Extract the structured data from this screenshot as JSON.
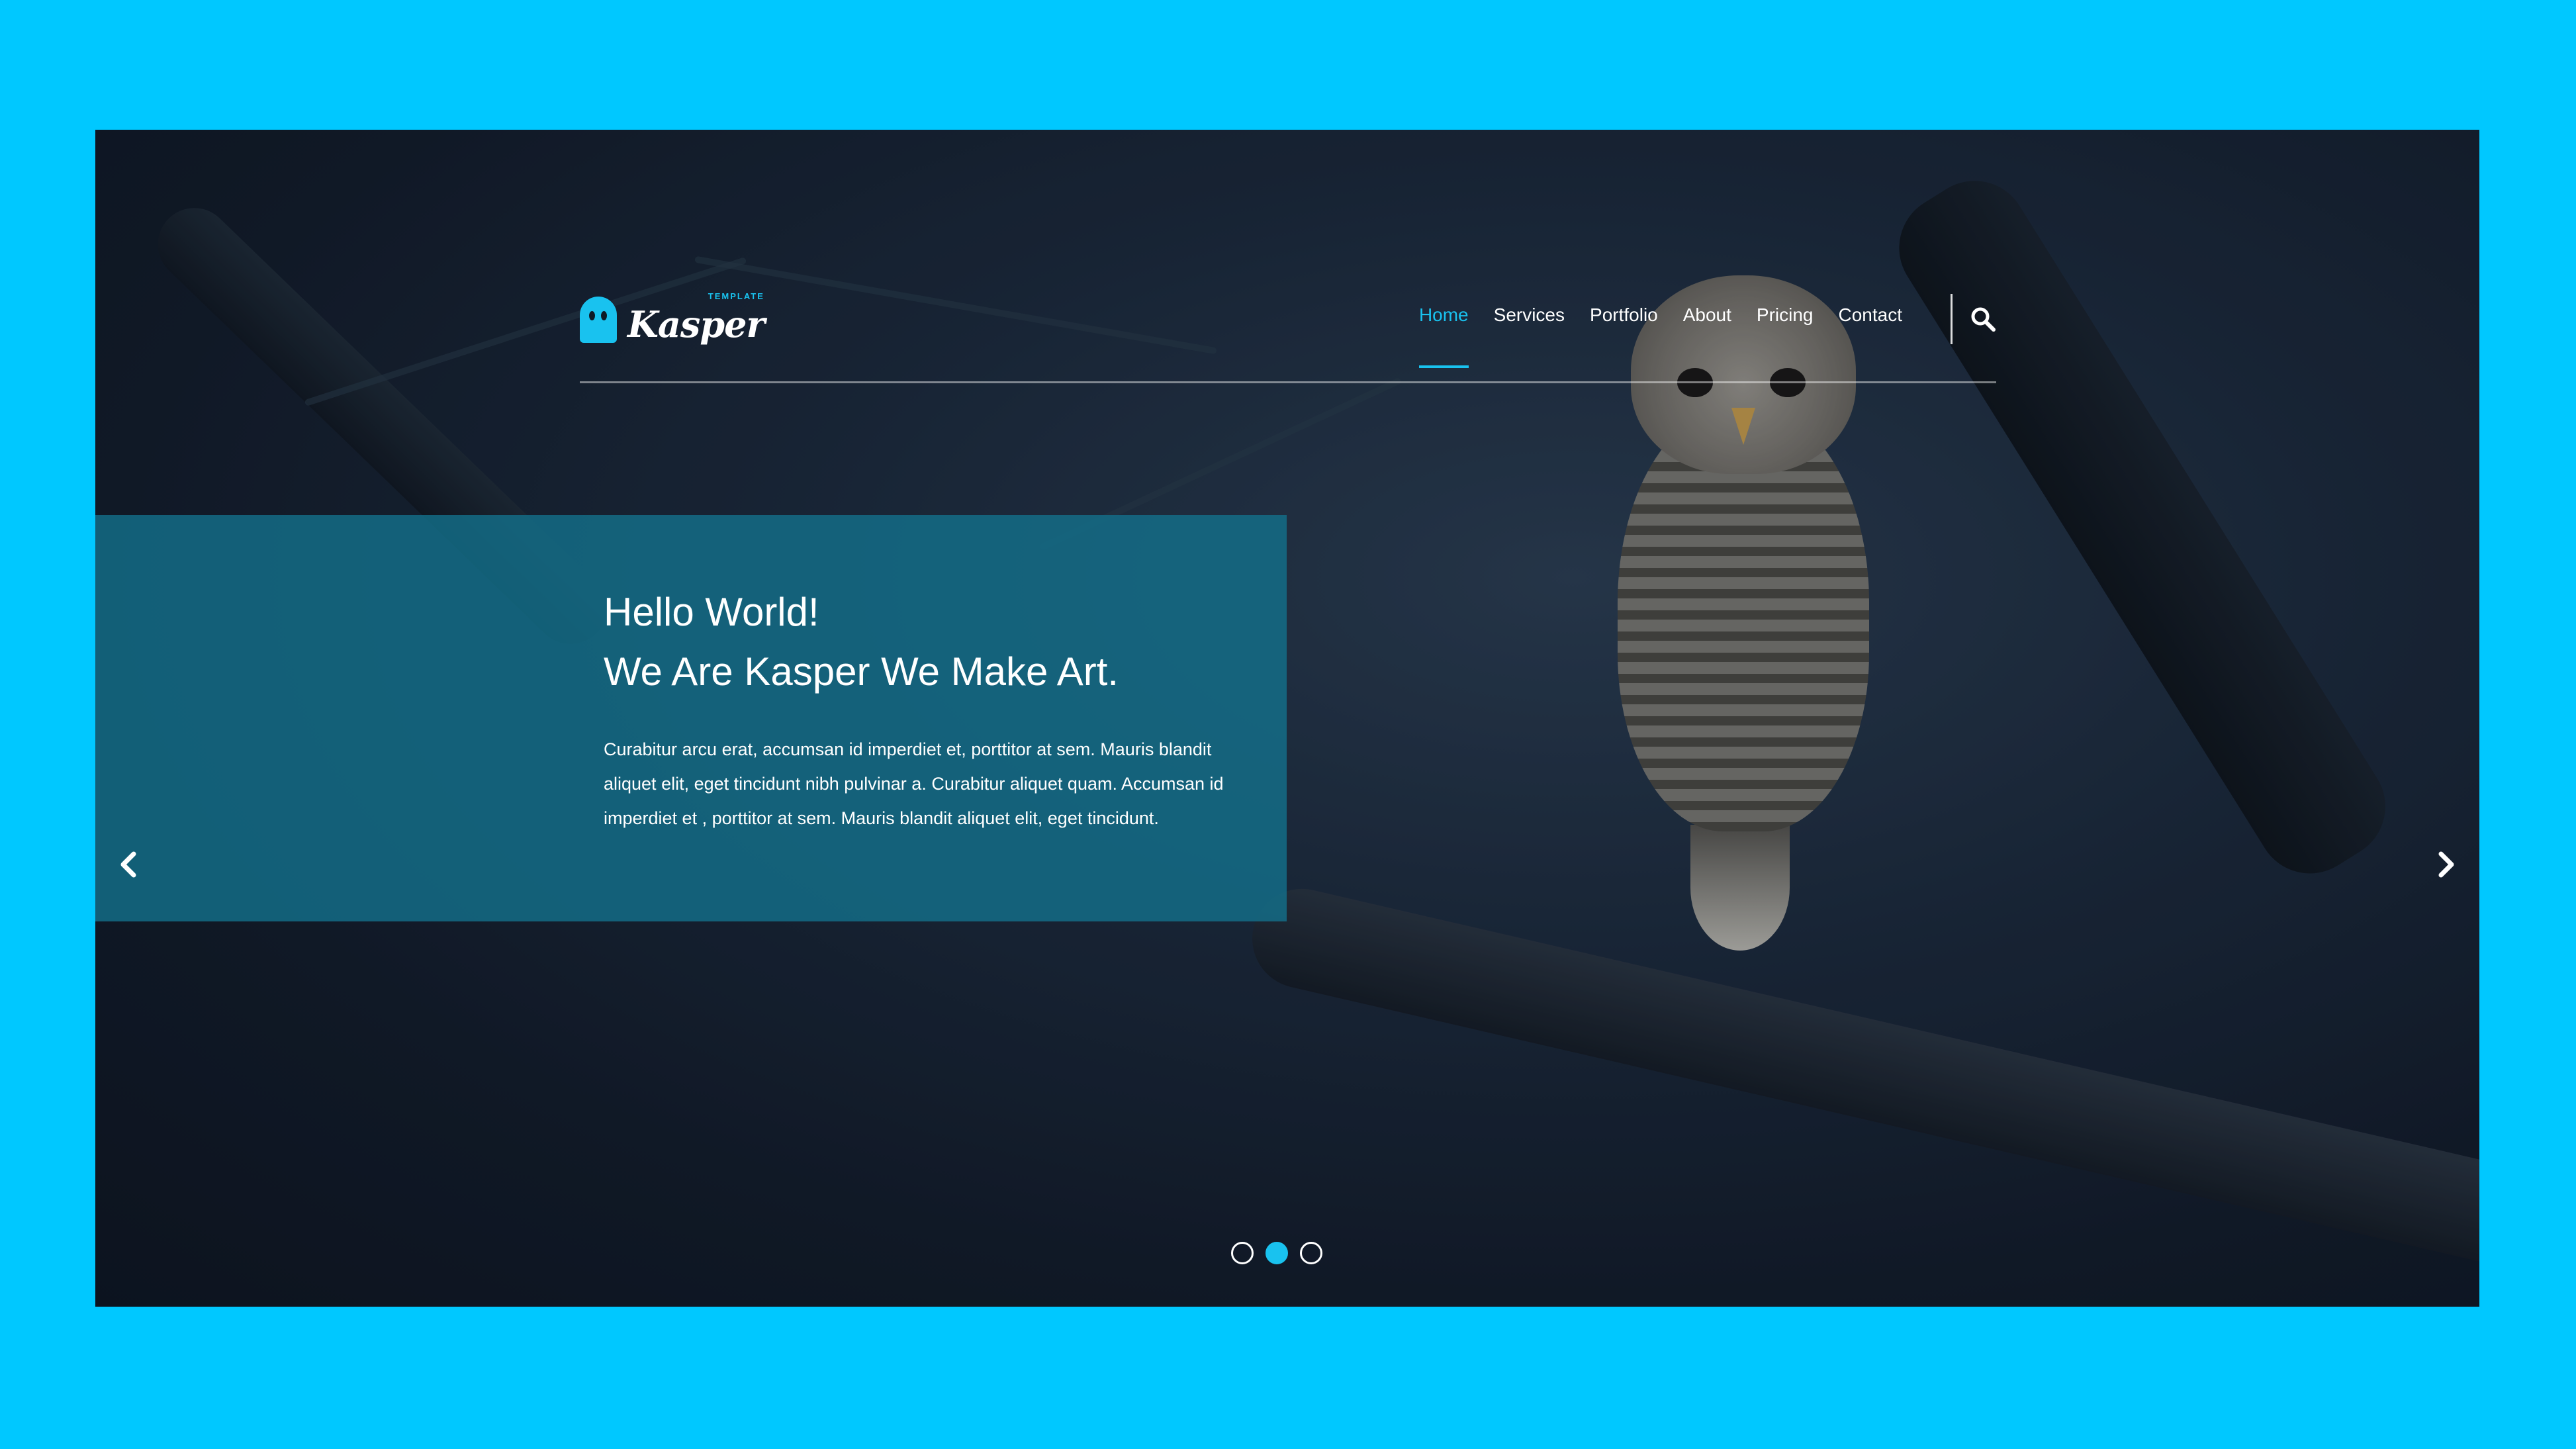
{
  "brand": {
    "name": "Kasper",
    "tagline": "TEMPLATE",
    "accent_color": "#19c2ef",
    "background_color": "#00c8ff"
  },
  "nav": {
    "items": [
      {
        "label": "Home",
        "active": true
      },
      {
        "label": "Services",
        "active": false
      },
      {
        "label": "Portfolio",
        "active": false
      },
      {
        "label": "About",
        "active": false
      },
      {
        "label": "Pricing",
        "active": false
      },
      {
        "label": "Contact",
        "active": false
      }
    ],
    "search_icon": "search-icon"
  },
  "hero": {
    "title_line1": "Hello World!",
    "title_line2": "We Are Kasper We Make Art.",
    "body": "Curabitur arcu erat, accumsan id imperdiet et, porttitor at sem. Mauris blandit aliquet elit, eget tincidunt nibh pulvinar a. Curabitur aliquet quam. Accumsan id imperdiet et , porttitor at sem. Mauris blandit aliquet elit, eget tincidunt.",
    "overlay_color": "#136f8a",
    "image_subject": "owl on branch"
  },
  "slider": {
    "prev_icon": "chevron-left-icon",
    "next_icon": "chevron-right-icon",
    "dots": [
      {
        "active": false
      },
      {
        "active": true
      },
      {
        "active": false
      }
    ]
  }
}
